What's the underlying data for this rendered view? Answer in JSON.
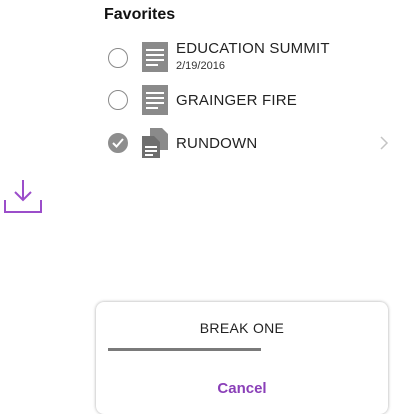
{
  "favorites": {
    "title": "Favorites",
    "items": [
      {
        "title": "EDUCATION SUMMIT",
        "subtitle": "2/19/2016",
        "selected": false,
        "icon": "document-icon"
      },
      {
        "title": "GRAINGER FIRE",
        "selected": false,
        "icon": "document-icon"
      },
      {
        "title": "RUNDOWN",
        "selected": true,
        "icon": "documents-stack-icon",
        "has_chevron": true
      }
    ]
  },
  "download": {
    "icon": "download-icon",
    "color": "#9b4dca"
  },
  "sheet": {
    "title": "BREAK ONE",
    "progress": 0.57,
    "cancel_label": "Cancel",
    "accent": "#8a3fb8"
  }
}
